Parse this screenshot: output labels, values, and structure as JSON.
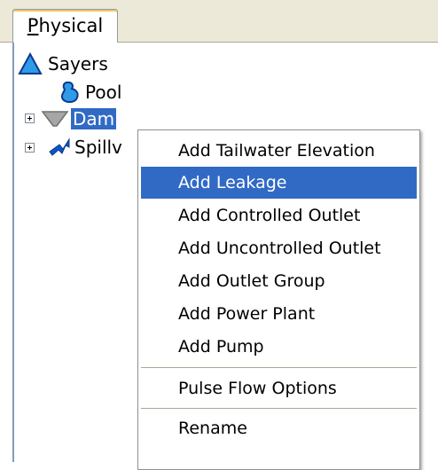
{
  "tab": {
    "label_mnemonic": "P",
    "label_rest": "hysical"
  },
  "tree": {
    "root": {
      "label": "Sayers",
      "icon": "triangle-icon"
    },
    "items": [
      {
        "label": "Pool",
        "icon": "pool-icon"
      },
      {
        "label": "Dam",
        "icon": "dam-icon",
        "selected": true
      },
      {
        "label": "Spillv",
        "icon": "spillway-icon"
      }
    ]
  },
  "context_menu": {
    "items": [
      {
        "label": "Add Tailwater Elevation"
      },
      {
        "label": "Add Leakage",
        "highlighted": true
      },
      {
        "label": "Add Controlled Outlet"
      },
      {
        "label": "Add Uncontrolled Outlet"
      },
      {
        "label": "Add Outlet Group"
      },
      {
        "label": "Add Power Plant"
      },
      {
        "label": "Add Pump"
      },
      {
        "label": "Pulse Flow Options"
      },
      {
        "label": "Rename"
      }
    ]
  },
  "colors": {
    "selection": "#316ac5",
    "tab_strip": "#ece9d8",
    "tab_accent": "#f6c463"
  }
}
